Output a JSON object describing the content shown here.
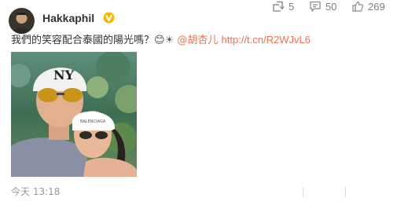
{
  "post": {
    "username": "Hakkaphil",
    "text": "我們的笑容配合泰國的陽光嗎？",
    "emoji_text": "😊☀",
    "mention": "@胡杏儿",
    "link": "http://t.cn/R2WJvL6",
    "timestamp": "今天 13:18"
  },
  "actions": {
    "repost_count": "5",
    "comment_count": "50",
    "like_count": "269"
  },
  "icons": [
    "verified-badge-icon",
    "repost-icon",
    "comment-icon",
    "like-icon"
  ],
  "colors": {
    "link": "#eb7350",
    "verified": "#f5b800",
    "secondary_text": "#999999"
  }
}
